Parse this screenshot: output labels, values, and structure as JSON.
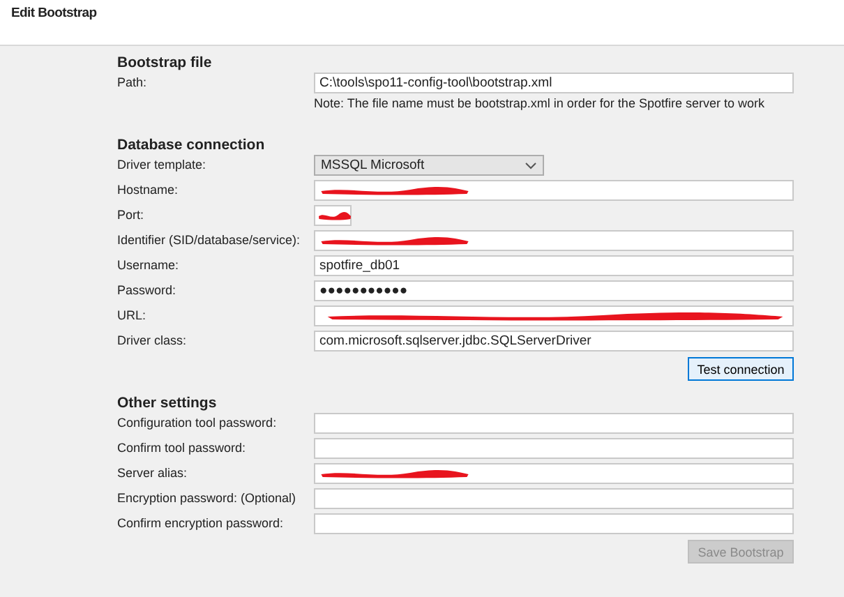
{
  "window": {
    "title": "Edit Bootstrap"
  },
  "sections": [
    {
      "title": "Bootstrap file",
      "fields": [
        {
          "label": "Path:",
          "kind": "text",
          "value": "C:\\tools\\spo11-config-tool\\bootstrap.xml",
          "note": "Note: The file name must be bootstrap.xml in order for the Spotfire server to work"
        }
      ]
    },
    {
      "title": "Database connection",
      "fields": [
        {
          "label": "Driver template:",
          "kind": "dropdown",
          "value": "MSSQL Microsoft"
        },
        {
          "label": "Hostname:",
          "kind": "text",
          "redacted": true
        },
        {
          "label": "Port:",
          "kind": "short",
          "redacted": true
        },
        {
          "label": "Identifier (SID/database/service):",
          "kind": "text",
          "redacted": true
        },
        {
          "label": "Username:",
          "kind": "text",
          "value": "spotfire_db01"
        },
        {
          "label": "Password:",
          "kind": "text",
          "value": "●●●●●●●●●●●"
        },
        {
          "label": "URL:",
          "kind": "wide",
          "redacted": true
        },
        {
          "label": "Driver class:",
          "kind": "text",
          "value": "com.microsoft.sqlserver.jdbc.SQLServerDriver"
        }
      ],
      "button": {
        "label": "Test connection",
        "disabled": false
      }
    },
    {
      "title": "Other settings",
      "fields": [
        {
          "label": "Configuration tool password:",
          "kind": "text",
          "redacted": false
        },
        {
          "label": "Confirm tool password:",
          "kind": "text",
          "redacted": false
        },
        {
          "label": "Server alias:",
          "kind": "text",
          "redacted": true
        },
        {
          "label": "Encryption password: (Optional)",
          "kind": "text",
          "redacted": false
        },
        {
          "label": "Confirm encryption password:",
          "kind": "text",
          "redacted": false
        }
      ],
      "button": {
        "label": "Save Bootstrap",
        "disabled": true
      }
    }
  ]
}
